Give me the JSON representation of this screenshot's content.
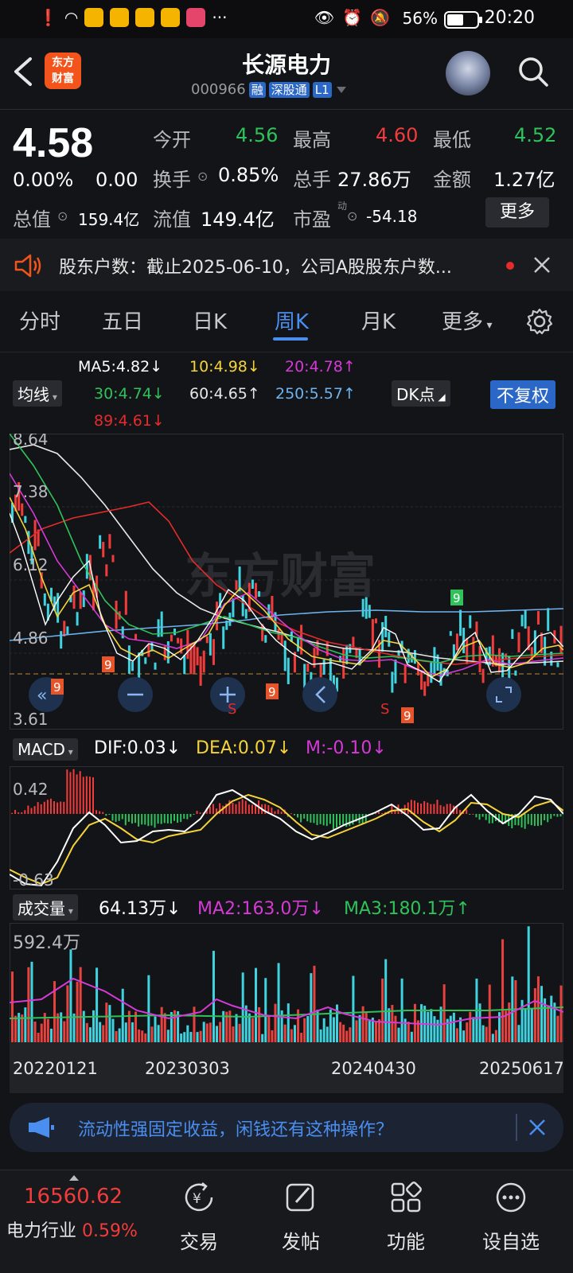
{
  "status": {
    "time": "20:20",
    "battery": "56%"
  },
  "header": {
    "logo": "东方\n财富",
    "title": "长源电力",
    "code": "000966",
    "tags": [
      "融",
      "深股通",
      "L1"
    ]
  },
  "quote": {
    "price": "4.58",
    "change_pct": "0.00%",
    "change": "0.00",
    "fields": [
      {
        "label": "今开",
        "value": "4.56",
        "color": "green"
      },
      {
        "label": "最高",
        "value": "4.60",
        "color": "red"
      },
      {
        "label": "最低",
        "value": "4.52",
        "color": "green"
      },
      {
        "label": "换手",
        "value": "0.85%",
        "color": "white"
      },
      {
        "label": "总手",
        "value": "27.86万",
        "color": "white"
      },
      {
        "label": "金额",
        "value": "1.27亿",
        "color": "white"
      },
      {
        "label": "总值",
        "value": "159.4亿",
        "color": "white"
      },
      {
        "label": "流值",
        "value": "149.4亿",
        "color": "white"
      },
      {
        "label": "市盈",
        "value": "-54.18",
        "color": "white"
      }
    ],
    "pe_sup": "动",
    "more_label": "更多"
  },
  "notice": {
    "text": "股东户数：截止2025-06-10，公司A股股东户数..."
  },
  "tabs": [
    "分时",
    "五日",
    "日K",
    "周K",
    "月K",
    "更多"
  ],
  "active_tab": 3,
  "ma_panel": {
    "selector": "均线",
    "ma5": "MA5:4.82",
    "ma10": "10:4.98",
    "ma20": "20:4.78",
    "ma30": "30:4.74",
    "ma60": "60:4.65",
    "ma250": "250:5.57",
    "ma89": "89:4.61",
    "dk_label": "DK点",
    "adjust_label": "不复权"
  },
  "kchart": {
    "y_labels": [
      "8.64",
      "7.38",
      "6.12",
      "4.86",
      "3.61"
    ],
    "watermark": "东方财富"
  },
  "macd": {
    "selector": "MACD",
    "dif": "DIF:0.03",
    "dea": "DEA:0.07",
    "m": "M:-0.10",
    "y_top": "0.42",
    "y_bottom": "-0.63"
  },
  "volume": {
    "selector": "成交量",
    "vol": "64.13万",
    "ma2": "MA2:163.0万",
    "ma3": "MA3:180.1万",
    "y_top": "592.4万",
    "x_labels": [
      "20220121",
      "20230303",
      "20240430",
      "20250617"
    ]
  },
  "ad": {
    "text": "流动性强固定收益，闲钱还有这种操作？"
  },
  "bottom": {
    "index_value": "16560.62",
    "index_name": "电力行业",
    "index_pct": "0.59%",
    "items": [
      "交易",
      "发帖",
      "功能",
      "设自选"
    ]
  },
  "colors": {
    "red": "#f23c3c",
    "green": "#2fc25b",
    "blue": "#4a8ef0",
    "yellow": "#f5d33a",
    "magenta": "#d63ad6"
  }
}
